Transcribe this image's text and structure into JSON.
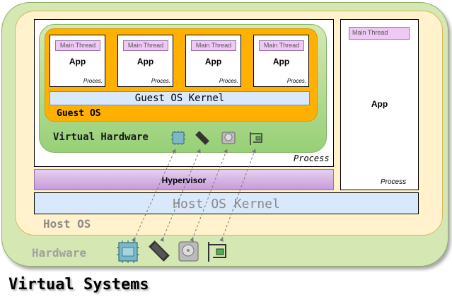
{
  "title": "Virtual Systems",
  "hardware": {
    "label": "Hardware",
    "icons": [
      "cpu-icon",
      "memory-icon",
      "disk-icon",
      "network-card-icon"
    ]
  },
  "host_os": {
    "label": "Host OS",
    "kernel_label": "Host OS Kernel"
  },
  "hypervisor": {
    "label": "Hypervisor"
  },
  "left_process": {
    "label": "Process",
    "virtual_hardware": {
      "label": "Virtual Hardware",
      "icons": [
        "cpu-icon",
        "memory-icon",
        "disk-icon",
        "network-card-icon"
      ]
    },
    "guest_os": {
      "label": "Guest OS",
      "kernel_label": "Guest OS Kernel",
      "apps": [
        {
          "thread": "Main Thread",
          "label": "App",
          "process": "Proces."
        },
        {
          "thread": "Main Thread",
          "label": "App",
          "process": "Proces."
        },
        {
          "thread": "Main Thread",
          "label": "App",
          "process": "Proces."
        },
        {
          "thread": "Main Thread",
          "label": "App",
          "process": "Proces."
        }
      ]
    }
  },
  "right_process": {
    "thread": "Main Thread",
    "label": "App",
    "process_label": "Process"
  },
  "colors": {
    "hardware_bg": "#d5e8b3",
    "host_os_bg": "#fff2cc",
    "guest_os_bg": "#ffb000",
    "kernel_bg": "#dae8fc",
    "thread_bg": "#f0c8f5",
    "hypervisor_bg": "#c79bd9"
  }
}
